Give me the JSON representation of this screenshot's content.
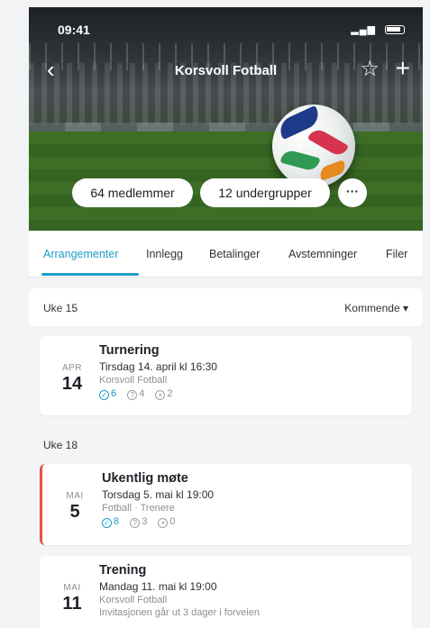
{
  "status_bar": {
    "time": "09:41",
    "signal": "▂▄▆"
  },
  "header": {
    "title": "Korsvoll Fotball",
    "back_icon": "‹",
    "star_icon": "☆",
    "add_icon": "+"
  },
  "chips": {
    "members": "64 medlemmer",
    "subgroups": "12 undergrupper",
    "more": "···"
  },
  "tabs": [
    "Arrangementer",
    "Innlegg",
    "Betalinger",
    "Avstemninger",
    "Filer"
  ],
  "week_1": {
    "label": "Uke 15",
    "sort_label": "Kommende ▾"
  },
  "week_2": {
    "label": "Uke 18"
  },
  "events": [
    {
      "month": "APR",
      "day": "14",
      "title": "Turnering",
      "when": "Tirsdag 14. april kl 16:30",
      "where": "Korsvoll Fotball",
      "yes": "6",
      "maybe": "4",
      "no": "2"
    },
    {
      "month": "MAI",
      "day": "5",
      "title": "Ukentlig møte",
      "when": "Torsdag 5. mai kl 19:00",
      "where": "Fotball · Trenere",
      "yes": "8",
      "maybe": "3",
      "no": "0"
    },
    {
      "month": "MAI",
      "day": "11",
      "title": "Trening",
      "when": "Mandag 11. mai kl 19:00",
      "where": "Korsvoll Fotball",
      "note": "Invitasjonen går ut 3 dager i forveien"
    }
  ],
  "colors": {
    "accent": "#1a9ec4",
    "highlight": "#e8524a"
  }
}
